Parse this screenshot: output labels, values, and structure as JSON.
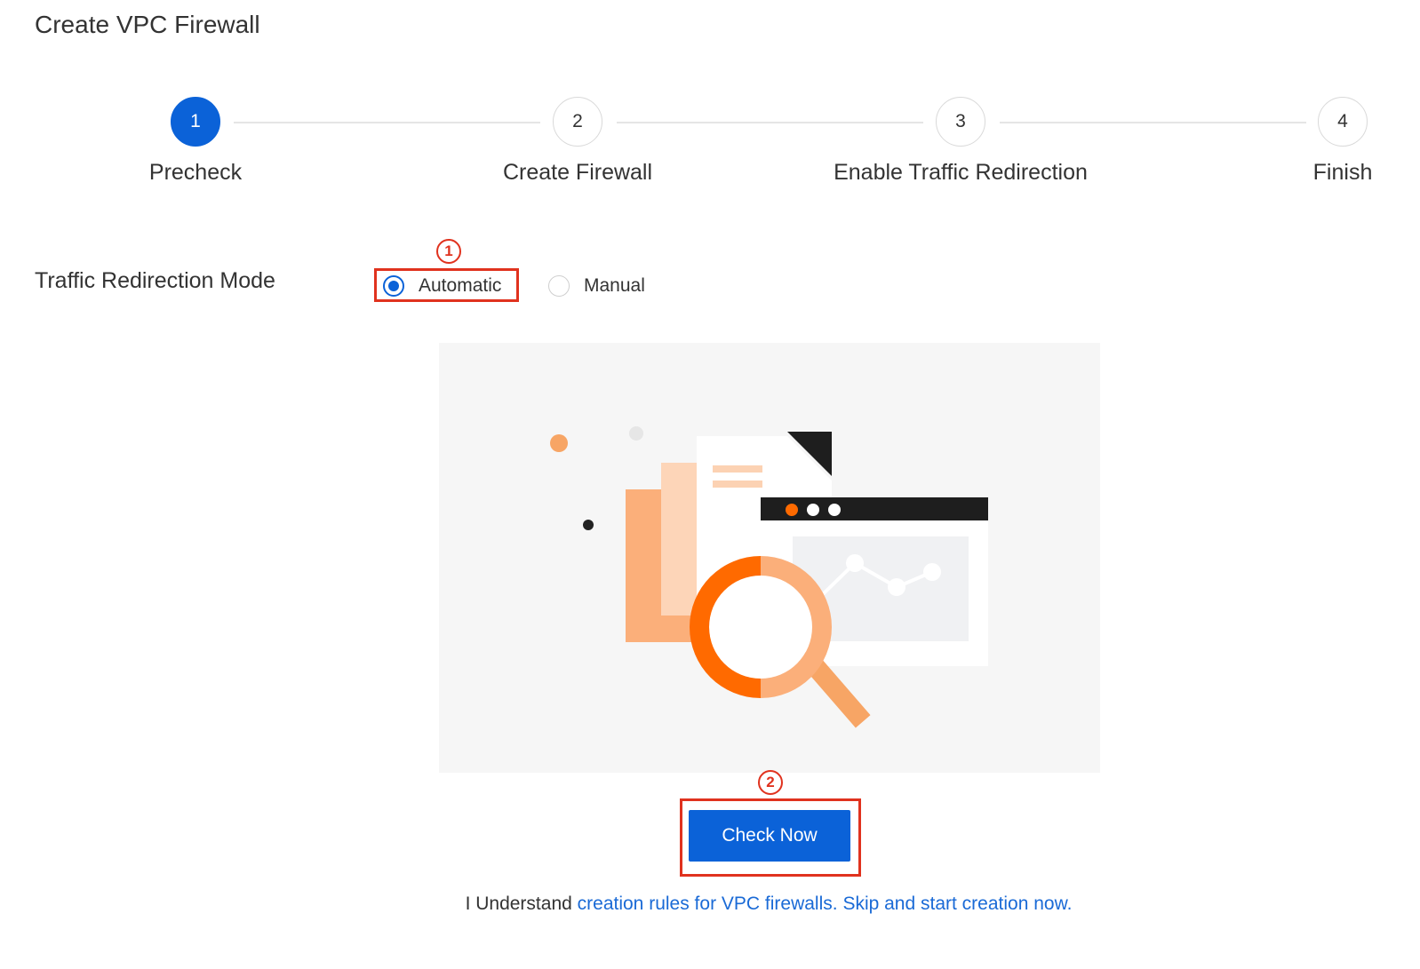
{
  "page": {
    "title": "Create VPC Firewall"
  },
  "steps": [
    {
      "number": "1",
      "label": "Precheck",
      "active": true
    },
    {
      "number": "2",
      "label": "Create Firewall",
      "active": false
    },
    {
      "number": "3",
      "label": "Enable Traffic Redirection",
      "active": false
    },
    {
      "number": "4",
      "label": "Finish",
      "active": false
    }
  ],
  "mode": {
    "label": "Traffic Redirection Mode",
    "options": [
      {
        "label": "Automatic",
        "checked": true
      },
      {
        "label": "Manual",
        "checked": false
      }
    ]
  },
  "annotations": {
    "badge1": "1",
    "badge2": "2",
    "color": "#e0321e"
  },
  "actions": {
    "check_now": "Check Now"
  },
  "footer": {
    "prefix": "I Understand",
    "link_rules": "creation rules for VPC firewalls.",
    "link_skip": "Skip and start creation now."
  },
  "colors": {
    "primary": "#0b62d8",
    "link": "#1a6ad6",
    "accent_orange": "#ff6a00"
  }
}
